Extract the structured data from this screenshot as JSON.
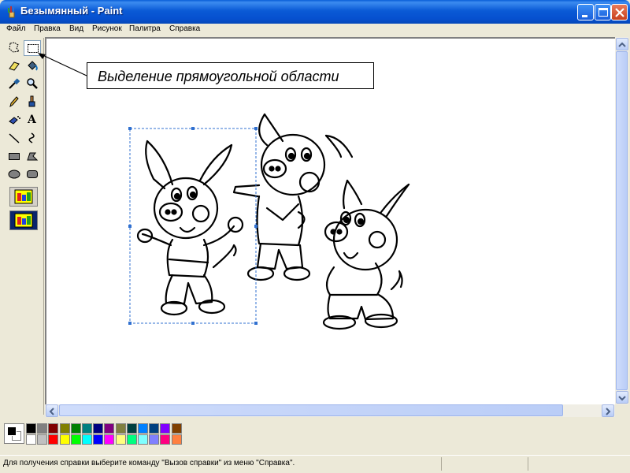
{
  "window": {
    "title": "Безымянный - Paint"
  },
  "menu": [
    "Файл",
    "Правка",
    "Вид",
    "Рисунок",
    "Палитра",
    "Справка"
  ],
  "tools": [
    {
      "icon": "free-form-select-icon"
    },
    {
      "icon": "rect-select-icon",
      "selected": true
    },
    {
      "icon": "eraser-icon"
    },
    {
      "icon": "fill-bucket-icon"
    },
    {
      "icon": "color-picker-icon"
    },
    {
      "icon": "magnifier-icon"
    },
    {
      "icon": "pencil-icon"
    },
    {
      "icon": "brush-icon"
    },
    {
      "icon": "airbrush-icon"
    },
    {
      "icon": "text-icon",
      "label": "A"
    },
    {
      "icon": "line-icon"
    },
    {
      "icon": "curve-icon"
    },
    {
      "icon": "rectangle-icon"
    },
    {
      "icon": "polygon-icon"
    },
    {
      "icon": "ellipse-icon"
    },
    {
      "icon": "rounded-rectangle-icon"
    }
  ],
  "callout": {
    "text": "Выделение прямоугольной области"
  },
  "palette": {
    "foreground": "#000000",
    "background": "#ffffff",
    "row1": [
      "#000000",
      "#808080",
      "#800000",
      "#808000",
      "#008000",
      "#008080",
      "#000080",
      "#800080",
      "#808040",
      "#004040",
      "#0080ff",
      "#004080",
      "#8000ff",
      "#804000"
    ],
    "row2": [
      "#ffffff",
      "#c0c0c0",
      "#ff0000",
      "#ffff00",
      "#00ff00",
      "#00ffff",
      "#0000ff",
      "#ff00ff",
      "#ffff80",
      "#00ff80",
      "#80ffff",
      "#8080ff",
      "#ff0080",
      "#ff8040"
    ]
  },
  "status": {
    "text": "Для получения справки выберите команду \"Вызов справки\" из меню \"Справка\"."
  }
}
